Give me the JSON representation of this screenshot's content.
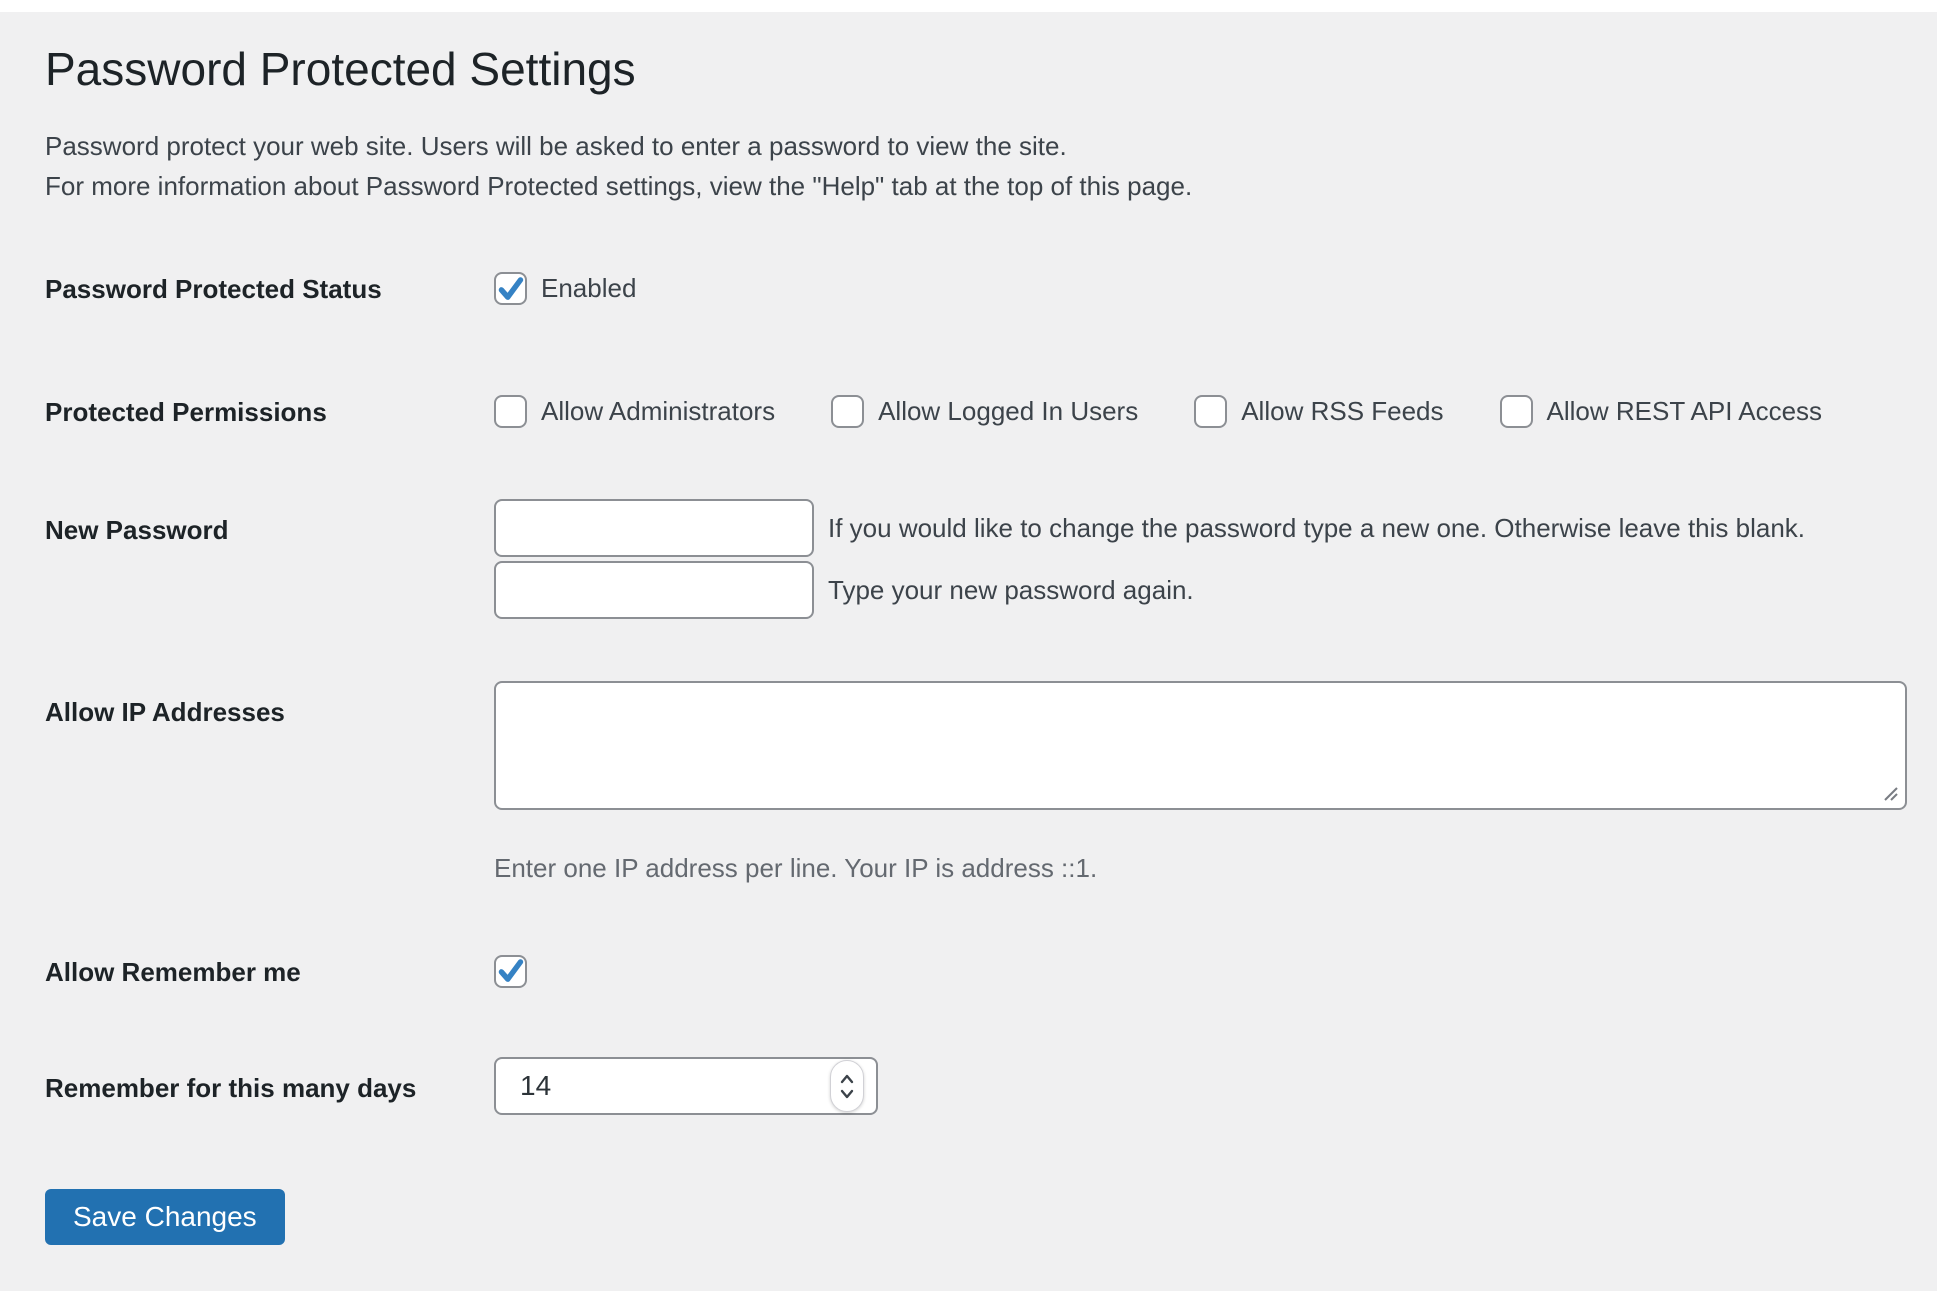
{
  "page": {
    "title": "Password Protected Settings",
    "intro_line1": "Password protect your web site. Users will be asked to enter a password to view the site.",
    "intro_line2": "For more information about Password Protected settings, view the \"Help\" tab at the top of this page."
  },
  "rows": {
    "status": {
      "label": "Password Protected Status",
      "checkbox_label": "Enabled",
      "checked": true
    },
    "permissions": {
      "label": "Protected Permissions",
      "options": [
        {
          "label": "Allow Administrators",
          "checked": false
        },
        {
          "label": "Allow Logged In Users",
          "checked": false
        },
        {
          "label": "Allow RSS Feeds",
          "checked": false
        },
        {
          "label": "Allow REST API Access",
          "checked": false
        }
      ]
    },
    "new_password": {
      "label": "New Password",
      "field1_value": "",
      "field1_desc": "If you would like to change the password type a new one. Otherwise leave this blank.",
      "field2_value": "",
      "field2_desc": "Type your new password again."
    },
    "allow_ip": {
      "label": "Allow IP Addresses",
      "value": "",
      "description": "Enter one IP address per line. Your IP is address ::1."
    },
    "remember": {
      "label": "Allow Remember me",
      "checked": true
    },
    "remember_days": {
      "label": "Remember for this many days",
      "value": "14"
    }
  },
  "button": {
    "save_label": "Save Changes"
  },
  "icons": {
    "checkmark": "check-icon",
    "spinner_up": "chevron-up-icon",
    "spinner_down": "chevron-down-icon",
    "resize": "resize-grip-icon"
  },
  "colors": {
    "background": "#f0f0f1",
    "heading_text": "#1d2327",
    "body_text": "#3c434a",
    "description_text": "#646970",
    "input_border": "#8c8f94",
    "accent_blue": "#2271b1",
    "checkmark_blue": "#3582c4"
  }
}
